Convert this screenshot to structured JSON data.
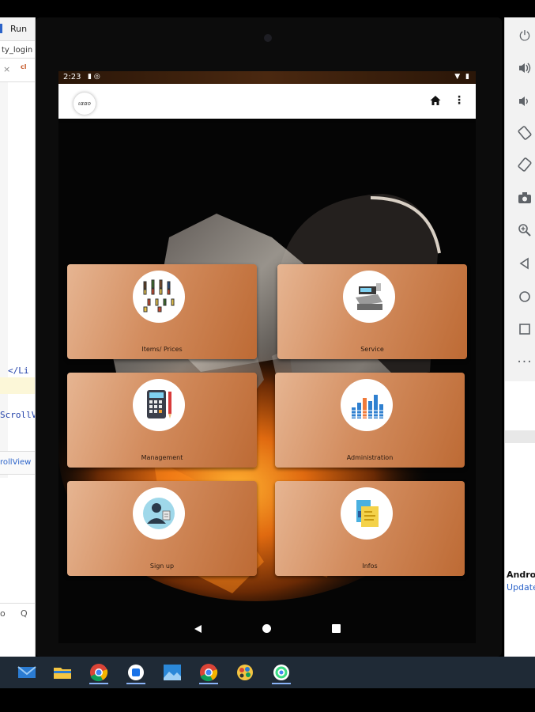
{
  "ide": {
    "run_label": "Run",
    "tab_label": "ty_login",
    "close_glyph": "×",
    "class_badge": "cl",
    "code_line_1": "</Li",
    "code_line_2": "ScrollV",
    "bottom_tab": "rollView",
    "status_glyph_1": "o",
    "status_glyph_2": "Q"
  },
  "emulator_panel": {
    "buttons": [
      "power-icon",
      "volume-up-icon",
      "volume-down-icon",
      "rotate-left-icon",
      "rotate-right-icon",
      "camera-icon",
      "zoom-icon",
      "back-icon",
      "home-icon",
      "overview-icon",
      "more-icon"
    ]
  },
  "notification": {
    "title": "Android",
    "link": "Update..."
  },
  "device": {
    "status_bar": {
      "time": "2:23"
    },
    "app_bar": {
      "logo_text": "ιααο",
      "home_icon": "home-icon",
      "menu_icon": "more-vert-icon"
    },
    "tiles": [
      {
        "label": "Items/ Prices",
        "icon": "bottles-icon"
      },
      {
        "label": "Service",
        "icon": "cash-register-icon"
      },
      {
        "label": "Management",
        "icon": "calculator-icon"
      },
      {
        "label": "Administration",
        "icon": "bar-chart-icon"
      },
      {
        "label": "Sign up",
        "icon": "user-signup-icon"
      },
      {
        "label": "Infos",
        "icon": "document-info-icon"
      }
    ]
  },
  "taskbar": {
    "items": [
      "mail-icon",
      "file-explorer-icon",
      "chrome-icon",
      "app-icon",
      "photos-icon",
      "chrome-icon",
      "paint-icon",
      "android-studio-icon"
    ],
    "colors": {
      "background": "#1f2a36",
      "accent": "#8ab4f8"
    }
  },
  "colors": {
    "tile_light": "#e6b592",
    "tile_dark": "#bd6a34",
    "appbar": "#ffffff"
  }
}
